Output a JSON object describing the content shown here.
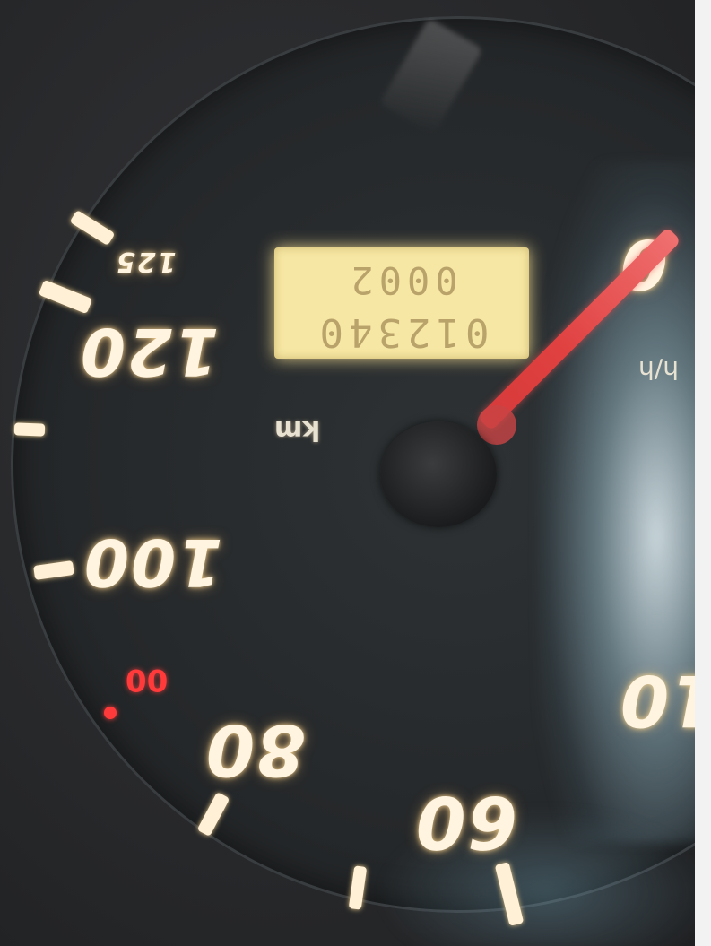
{
  "speedometer": {
    "scale_labels": {
      "n125": "125",
      "n120": "120",
      "n100": "100",
      "n80": "80",
      "n60": "60",
      "n10": "10",
      "n0": "0"
    },
    "red_label": "00",
    "odometer": {
      "trip": "0002",
      "total": "012340"
    },
    "distance_unit": "km",
    "speed_unit": "h/h"
  },
  "colors": {
    "needle": "#e04040",
    "display_backlight": "#f6e7a4",
    "numerals": "#fff4e0",
    "red_mark": "#ff3a3a"
  },
  "icons": {
    "needle": "needle-icon"
  }
}
